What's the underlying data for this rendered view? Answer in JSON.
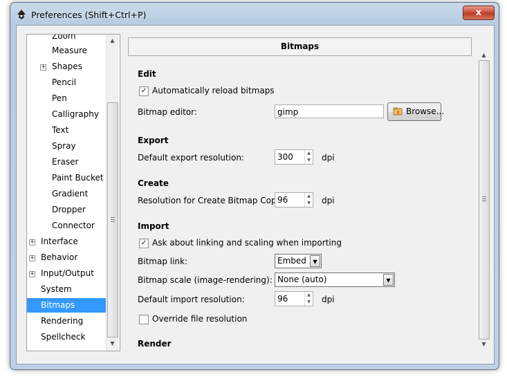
{
  "window": {
    "title": "Preferences (Shift+Ctrl+P)",
    "close_label": "x"
  },
  "tree": {
    "items": [
      {
        "label": "Zoom",
        "expander": ""
      },
      {
        "label": "Measure",
        "expander": ""
      },
      {
        "label": "Shapes",
        "expander": "+"
      },
      {
        "label": "Pencil",
        "expander": ""
      },
      {
        "label": "Pen",
        "expander": ""
      },
      {
        "label": "Calligraphy",
        "expander": ""
      },
      {
        "label": "Text",
        "expander": ""
      },
      {
        "label": "Spray",
        "expander": ""
      },
      {
        "label": "Eraser",
        "expander": ""
      },
      {
        "label": "Paint Bucket",
        "expander": ""
      },
      {
        "label": "Gradient",
        "expander": ""
      },
      {
        "label": "Dropper",
        "expander": ""
      },
      {
        "label": "Connector",
        "expander": ""
      },
      {
        "label": "Interface",
        "expander": "+"
      },
      {
        "label": "Behavior",
        "expander": "+"
      },
      {
        "label": "Input/Output",
        "expander": "+"
      },
      {
        "label": "System",
        "expander": ""
      },
      {
        "label": "Bitmaps",
        "expander": "",
        "selected": true
      },
      {
        "label": "Rendering",
        "expander": ""
      },
      {
        "label": "Spellcheck",
        "expander": ""
      }
    ]
  },
  "panel": {
    "title": "Bitmaps",
    "edit": {
      "heading": "Edit",
      "auto_reload": {
        "label": "Automatically reload bitmaps",
        "checked": true,
        "mark": "✓"
      },
      "bitmap_editor": {
        "label": "Bitmap editor:",
        "value": "gimp"
      },
      "browse_label": "Browse..."
    },
    "export": {
      "heading": "Export",
      "resolution": {
        "label": "Default export resolution:",
        "value": "300",
        "unit": "dpi"
      }
    },
    "create": {
      "heading": "Create",
      "resolution": {
        "label": "Resolution for Create Bitmap Copy:",
        "value": "96",
        "unit": "dpi"
      }
    },
    "import": {
      "heading": "Import",
      "ask_linking": {
        "label": "Ask about linking and scaling when importing",
        "checked": true,
        "mark": "✓"
      },
      "bitmap_link": {
        "label": "Bitmap link:",
        "value": "Embed"
      },
      "bitmap_scale": {
        "label": "Bitmap scale (image-rendering):",
        "value": "None (auto)"
      },
      "resolution": {
        "label": "Default import resolution:",
        "value": "96",
        "unit": "dpi"
      },
      "override": {
        "label": "Override file resolution",
        "checked": false,
        "mark": ""
      }
    },
    "render": {
      "heading": "Render"
    }
  },
  "colors": {
    "selection": "#3399ff",
    "close_button": "#c94a36"
  }
}
